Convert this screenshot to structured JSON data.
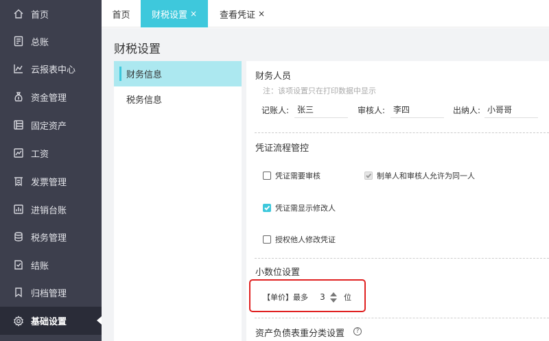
{
  "sidebar": {
    "items": [
      {
        "label": "首页",
        "icon": "home-icon"
      },
      {
        "label": "总账",
        "icon": "ledger-icon"
      },
      {
        "label": "云报表中心",
        "icon": "chart-icon"
      },
      {
        "label": "资金管理",
        "icon": "money-bag-icon"
      },
      {
        "label": "固定资产",
        "icon": "asset-icon"
      },
      {
        "label": "工资",
        "icon": "salary-icon"
      },
      {
        "label": "发票管理",
        "icon": "invoice-icon"
      },
      {
        "label": "进销台账",
        "icon": "inventory-icon"
      },
      {
        "label": "税务管理",
        "icon": "tax-icon"
      },
      {
        "label": "结账",
        "icon": "close-books-icon"
      },
      {
        "label": "归档管理",
        "icon": "archive-icon"
      },
      {
        "label": "基础设置",
        "icon": "gear-icon"
      }
    ],
    "active_index": 11
  },
  "tabs": [
    {
      "label": "首页",
      "closable": false
    },
    {
      "label": "财税设置",
      "closable": true
    },
    {
      "label": "查看凭证",
      "closable": true
    }
  ],
  "tab_close": "×",
  "page_title": "财税设置",
  "left_menu": {
    "items": [
      "财务信息",
      "税务信息"
    ]
  },
  "finance_staff": {
    "title": "财务人员",
    "note": "注：该项设置只在打印数据中显示",
    "bookkeeper_label": "记账人:",
    "bookkeeper_value": "张三",
    "reviewer_label": "审核人:",
    "reviewer_value": "李四",
    "cashier_label": "出纳人:",
    "cashier_value": "小哥哥"
  },
  "voucher_flow": {
    "title": "凭证流程管控",
    "require_review": "凭证需要审核",
    "same_person": "制单人和审核人允许为同一人",
    "show_modifier": "凭证需显示修改人",
    "authorize_edit": "授权他人修改凭证"
  },
  "decimal": {
    "title": "小数位设置",
    "label": "【单价】最多",
    "value": "3",
    "unit": "位"
  },
  "balance_reclass": {
    "title": "资产负债表重分类设置",
    "help": "?"
  },
  "colors": {
    "accent": "#3ec8dc",
    "sidebar_bg": "#3d3f4d",
    "highlight": "#e02020"
  }
}
